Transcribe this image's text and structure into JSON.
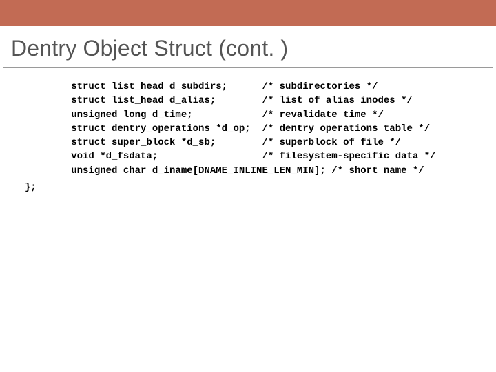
{
  "title": "Dentry Object Struct (cont. )",
  "code": {
    "lines": [
      {
        "decl": "struct list_head d_subdirs;",
        "comment": "/* subdirectories */"
      },
      {
        "decl": "struct list_head d_alias;",
        "comment": "/* list of alias inodes */"
      },
      {
        "decl": "unsigned long d_time;",
        "comment": "/* revalidate time */"
      },
      {
        "decl": "struct dentry_operations *d_op;",
        "comment": "/* dentry operations table */"
      },
      {
        "decl": "struct super_block *d_sb;",
        "comment": "/* superblock of file */"
      },
      {
        "decl": "void *d_fsdata;",
        "comment": "/* filesystem-specific data */"
      }
    ],
    "last_line": "unsigned char d_iname[DNAME_INLINE_LEN_MIN]; /* short name */",
    "close": "};"
  },
  "layout": {
    "indent_spaces": 8,
    "comment_col": 33
  }
}
